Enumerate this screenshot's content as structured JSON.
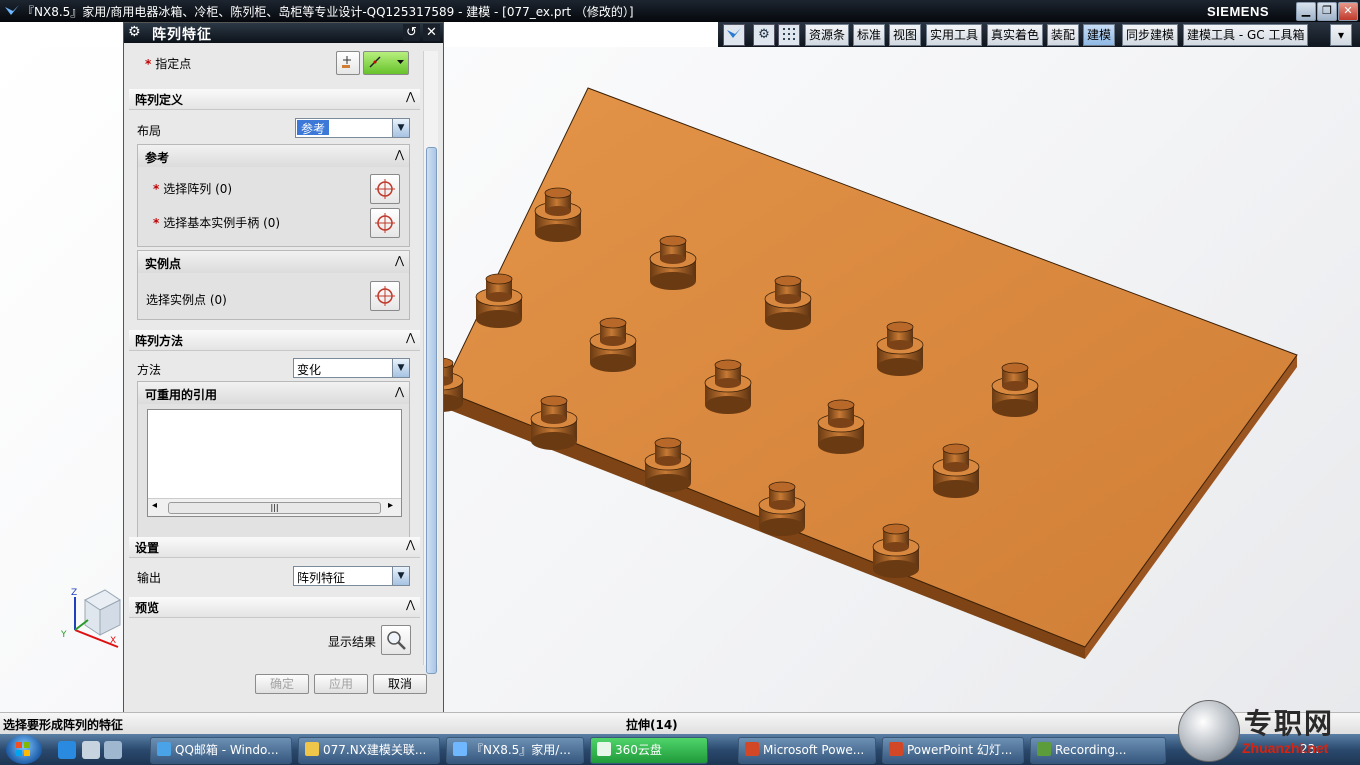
{
  "window": {
    "title": "『NX8.5』家用/商用电器冰箱、冷柜、陈列柜、岛柜等专业设计-QQ125317589 - 建模 - [077_ex.prt （修改的）]",
    "brand": "SIEMENS",
    "min_glyph": "▁",
    "max_glyph": "❐",
    "close_glyph": "✕"
  },
  "toolbar": {
    "icon_glyph": "⚙",
    "tabs": [
      "资源条",
      "标准",
      "视图",
      "实用工具",
      "真实着色",
      "装配",
      "建模",
      "同步建模",
      "建模工具 - GC 工具箱"
    ],
    "active_tab": "建模",
    "more_glyph": "▾"
  },
  "dialog": {
    "title": "阵列特征",
    "gear_glyph": "⚙",
    "reset_glyph": "↺",
    "close_glyph": "✕",
    "specify_point": "指定点",
    "required_mark": "*",
    "chevron_glyph": "⋀",
    "sections": {
      "array_definition": "阵列定义",
      "layout_label": "布局",
      "layout_value": "参考",
      "reference": "参考",
      "select_array": "选择阵列 (0)",
      "select_base_handle": "选择基本实例手柄 (0)",
      "instance_point": "实例点",
      "select_instance_point": "选择实例点 (0)",
      "array_method": "阵列方法",
      "method_label": "方法",
      "method_value": "变化",
      "reusable_refs": "可重用的引用",
      "settings": "设置",
      "output_label": "输出",
      "output_value": "阵列特征",
      "preview": "预览",
      "show_result": "显示结果"
    },
    "buttons": {
      "ok": "确定",
      "apply": "应用",
      "cancel": "取消"
    },
    "scroll_grip": "|||"
  },
  "axes": {
    "z": "Z",
    "x": "X",
    "y": "Y"
  },
  "statusbar": {
    "prompt": "选择要形成阵列的特征",
    "status": "拉伸(14)"
  },
  "taskbar": {
    "items": [
      "QQ邮箱 - Windo...",
      "077.NX建模关联...",
      "『NX8.5』家用/...",
      "360云盘",
      "Microsoft Powe...",
      "PowerPoint 幻灯...",
      "Recording..."
    ],
    "active_item": "360云盘",
    "clock": "23:"
  },
  "watermark": {
    "text": "专职网",
    "url": "Zhuanzhi.net"
  },
  "colors": {
    "plate_top": "#d9883f",
    "plate_side": "#8a4e1c",
    "boss": "#b8692a"
  }
}
